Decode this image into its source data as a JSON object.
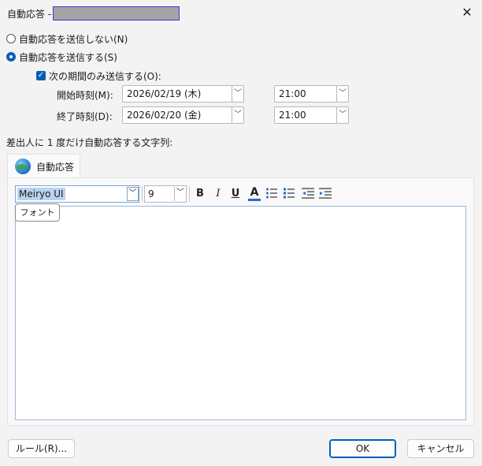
{
  "window": {
    "title_prefix": "自動応答 -",
    "close_glyph": "✕"
  },
  "options": {
    "no_send_label": "自動応答を送信しない(N)",
    "send_label": "自動応答を送信する(S)",
    "period_label": "次の期間のみ送信する(O):"
  },
  "period": {
    "start_label": "開始時刻(M):",
    "start_date": "2026/02/19 (木)",
    "start_time": "21:00",
    "end_label": "終了時刻(D):",
    "end_date": "2026/02/20 (金)",
    "end_time": "21:00"
  },
  "message": {
    "heading": "差出人に 1 度だけ自動応答する文字列:",
    "tab_label": "自動応答"
  },
  "format": {
    "font_name": "Meiryo UI",
    "font_size": "9",
    "bold": "B",
    "italic": "I",
    "underline": "U",
    "font_color": "A",
    "tooltip": "フォント"
  },
  "footer": {
    "rules_label": "ルール(R)...",
    "ok_label": "OK",
    "cancel_label": "キャンセル"
  },
  "colors": {
    "accent": "#005fb8",
    "font_color_bar": "#1f6fc6"
  }
}
